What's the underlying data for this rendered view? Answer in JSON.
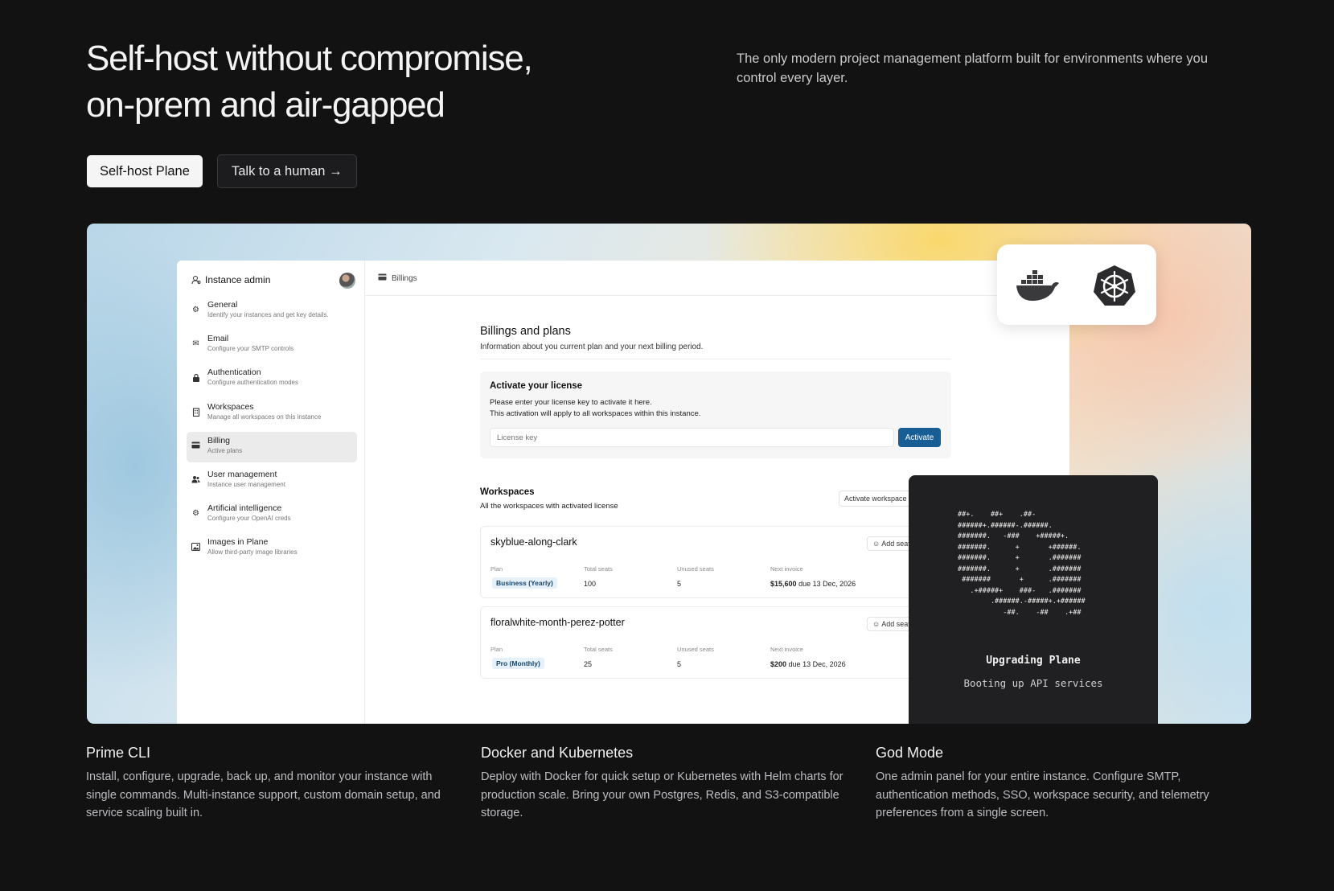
{
  "hero": {
    "title_line1": "Self-host without compromise,",
    "title_line2": "on-prem and air-gapped",
    "subtitle": "The only modern project management platform built for environments where you control every layer.",
    "primary_button": "Self-host Plane",
    "secondary_button": "Talk to a human →"
  },
  "app": {
    "sidebar": {
      "title": "Instance admin",
      "items": [
        {
          "title": "General",
          "desc": "Identify your instances and get key details.",
          "icon": "gear-icon"
        },
        {
          "title": "Email",
          "desc": "Configure your SMTP controls",
          "icon": "mail-icon"
        },
        {
          "title": "Authentication",
          "desc": "Configure authentication modes",
          "icon": "lock-icon"
        },
        {
          "title": "Workspaces",
          "desc": "Manage all workspaces on this instance",
          "icon": "building-icon"
        },
        {
          "title": "Billing",
          "desc": "Active plans",
          "icon": "card-icon"
        },
        {
          "title": "User management",
          "desc": "Instance user management",
          "icon": "users-icon"
        },
        {
          "title": "Artificial intelligence",
          "desc": "Configure your OpenAI creds",
          "icon": "gear-icon"
        },
        {
          "title": "Images in Plane",
          "desc": "Allow third-party image libraries",
          "icon": "image-icon"
        }
      ],
      "active_index": 4
    },
    "breadcrumb": "Billings",
    "page_title": "Billings and plans",
    "page_subtitle": "Information about you current plan and your next billing period.",
    "license": {
      "title": "Activate your license",
      "line1": "Please enter your license key to activate it here.",
      "line2": "This activation will apply to all workspaces within this instance.",
      "placeholder": "License key",
      "button": "Activate"
    },
    "workspaces": {
      "title": "Workspaces",
      "subtitle": "All the workspaces with activated license",
      "activate_button": "Activate workspace",
      "columns": {
        "plan": "Plan",
        "total": "Total seats",
        "unused": "Unused seats",
        "invoice": "Next invoice"
      },
      "add_seats": "Add seats",
      "due_prefix": "due",
      "items": [
        {
          "name": "skyblue-along-clark",
          "plan": "Business (Yearly)",
          "total": "100",
          "unused": "5",
          "amount": "$15,600",
          "due": "13 Dec, 2026"
        },
        {
          "name": "floralwhite-month-perez-potter",
          "plan": "Pro (Monthly)",
          "total": "25",
          "unused": "5",
          "amount": "$200",
          "due": "13 Dec, 2026"
        }
      ]
    },
    "integrations": {
      "docker_icon": "docker-icon",
      "kubernetes_icon": "kubernetes-icon"
    },
    "terminal": {
      "ascii": "##+.    ##+    .##-\n######+.######-.######.\n#######.   -###    +#####+.\n#######.      +       +######.\n#######.      +       .#######\n#######.      +       .#######\n #######       +      .#######\n   .+#####+    ###-   .#######\n        .######.-#####+.+######\n           -##.    -##    .+##",
      "title": "Upgrading Plane",
      "subtitle": "Booting up API services"
    }
  },
  "features": [
    {
      "title": "Prime CLI",
      "desc": "Install, configure, upgrade, back up, and monitor your instance with single commands. Multi-instance support, custom domain setup, and service scaling built in."
    },
    {
      "title": "Docker and Kubernetes",
      "desc": "Deploy with Docker for quick setup or Kubernetes with Helm charts for production scale. Bring your own Postgres, Redis, and S3-compatible storage."
    },
    {
      "title": "God Mode",
      "desc": "One admin panel for your entire instance. Configure SMTP, authentication methods, SSO, workspace security, and telemetry preferences from a single screen."
    }
  ]
}
